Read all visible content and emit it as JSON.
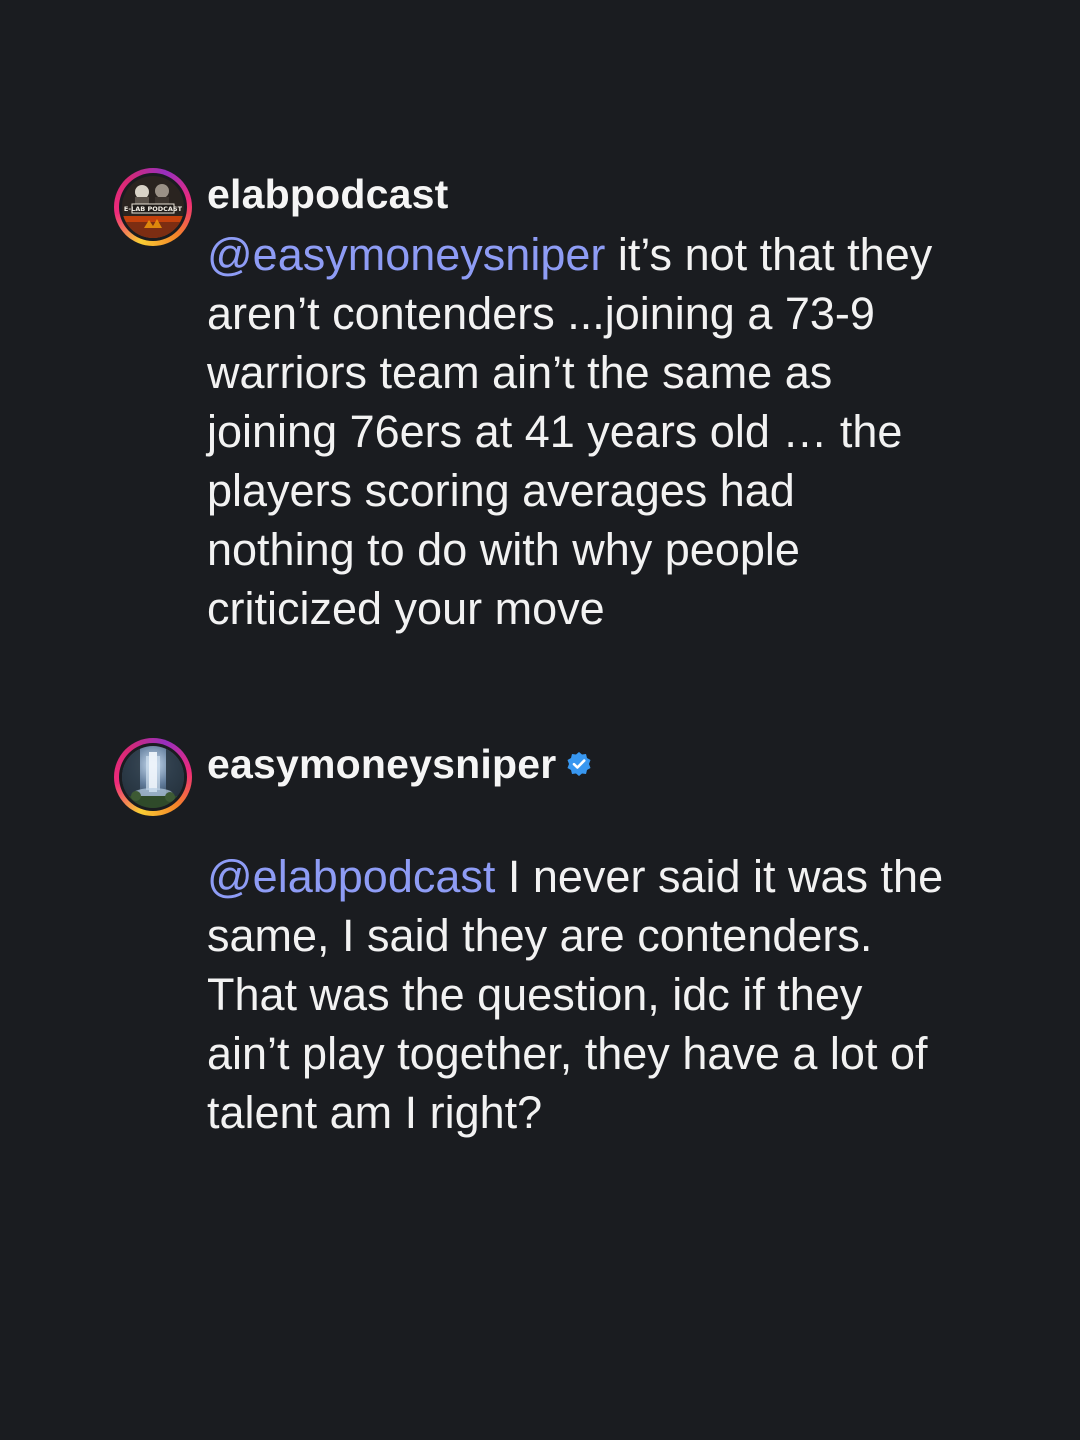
{
  "colors": {
    "background": "#1a1c20",
    "text": "#f2f2f2",
    "mention": "#8e9cf5",
    "verified": "#3897f0"
  },
  "comments": [
    {
      "username": "elabpodcast",
      "verified": false,
      "avatar_icon": "elab-podcast-logo-avatar",
      "avatar_text": "E-LAB PODCAST",
      "mention": "@easymoneysniper",
      "text": " it’s not that they aren’t contenders ...joining a 73-9 warriors team ain’t the same as joining 76ers at 41 years old … the players scoring averages had nothing to do with why people criticized your move"
    },
    {
      "username": "easymoneysniper",
      "verified": true,
      "avatar_icon": "waterfall-avatar",
      "mention": "@elabpodcast",
      "text": " I never said it was the same, I said they are contenders. That was the question, idc if they ain’t play together, they have a lot of talent am I right?"
    }
  ]
}
